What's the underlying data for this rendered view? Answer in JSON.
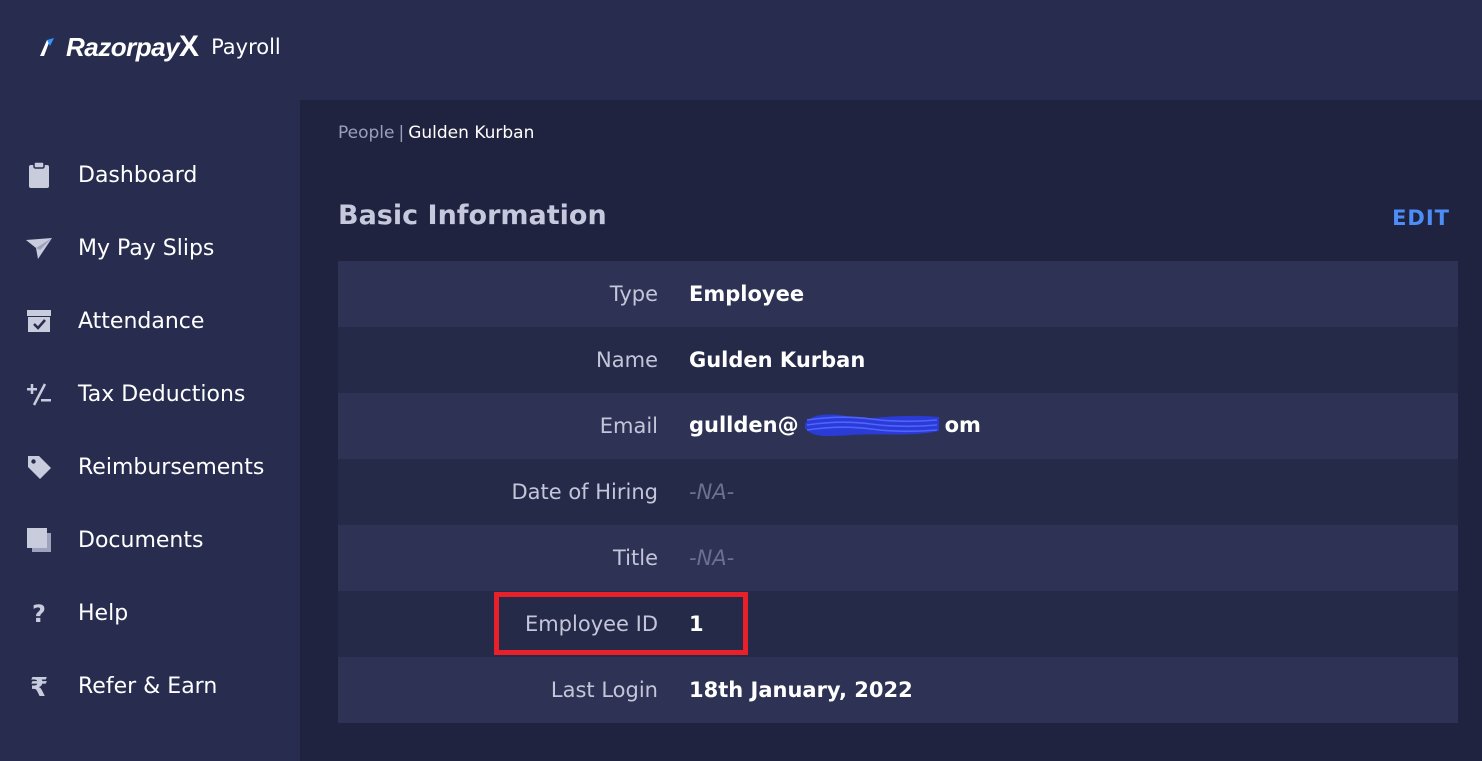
{
  "brand": {
    "name": "Razorpay",
    "name_suffix": "X",
    "product": "Payroll"
  },
  "sidebar": {
    "items": [
      {
        "label": "Dashboard",
        "icon": "clipboard-icon"
      },
      {
        "label": "My Pay Slips",
        "icon": "paper-plane-icon"
      },
      {
        "label": "Attendance",
        "icon": "calendar-check-icon"
      },
      {
        "label": "Tax Deductions",
        "icon": "plus-minus-icon"
      },
      {
        "label": "Reimbursements",
        "icon": "tag-icon"
      },
      {
        "label": "Documents",
        "icon": "documents-icon"
      },
      {
        "label": "Help",
        "icon": "question-icon"
      },
      {
        "label": "Refer & Earn",
        "icon": "rupee-icon"
      }
    ]
  },
  "breadcrumb": {
    "parent": "People",
    "separator": "|",
    "current": "Gulden Kurban"
  },
  "section": {
    "title": "Basic Information",
    "edit_label": "EDIT"
  },
  "info": {
    "rows": [
      {
        "key": "Type",
        "value": "Employee"
      },
      {
        "key": "Name",
        "value": "Gulden Kurban"
      },
      {
        "key": "Email",
        "value_prefix": "gullden@",
        "value_suffix": "om"
      },
      {
        "key": "Date of Hiring",
        "value": "-NA-"
      },
      {
        "key": "Title",
        "value": "-NA-"
      },
      {
        "key": "Employee ID",
        "value": "1"
      },
      {
        "key": "Last Login",
        "value": "18th January, 2022"
      }
    ]
  },
  "colors": {
    "background": "#282d4f",
    "main_panel": "#20233f",
    "accent": "#4c8ef7",
    "highlight": "#e8202a"
  }
}
